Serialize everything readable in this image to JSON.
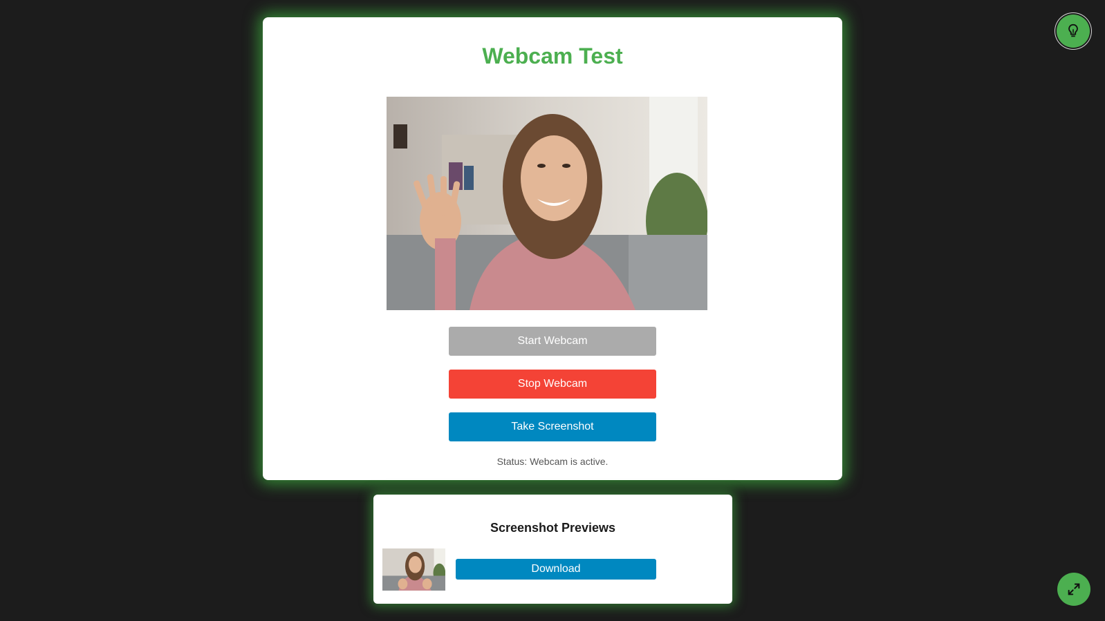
{
  "app": {
    "title": "Webcam Test"
  },
  "controls": {
    "start_label": "Start Webcam",
    "stop_label": "Stop Webcam",
    "screenshot_label": "Take Screenshot",
    "status_text": "Status: Webcam is active."
  },
  "previews": {
    "title": "Screenshot Previews",
    "items": [
      {
        "download_label": "Download"
      }
    ]
  },
  "icons": {
    "hint": "lightbulb-icon",
    "fullscreen": "expand-icon"
  },
  "colors": {
    "accent": "#4caf50",
    "start_disabled": "#ababab",
    "stop": "#f44336",
    "primary": "#0088c0",
    "background": "#1c1c1c"
  }
}
